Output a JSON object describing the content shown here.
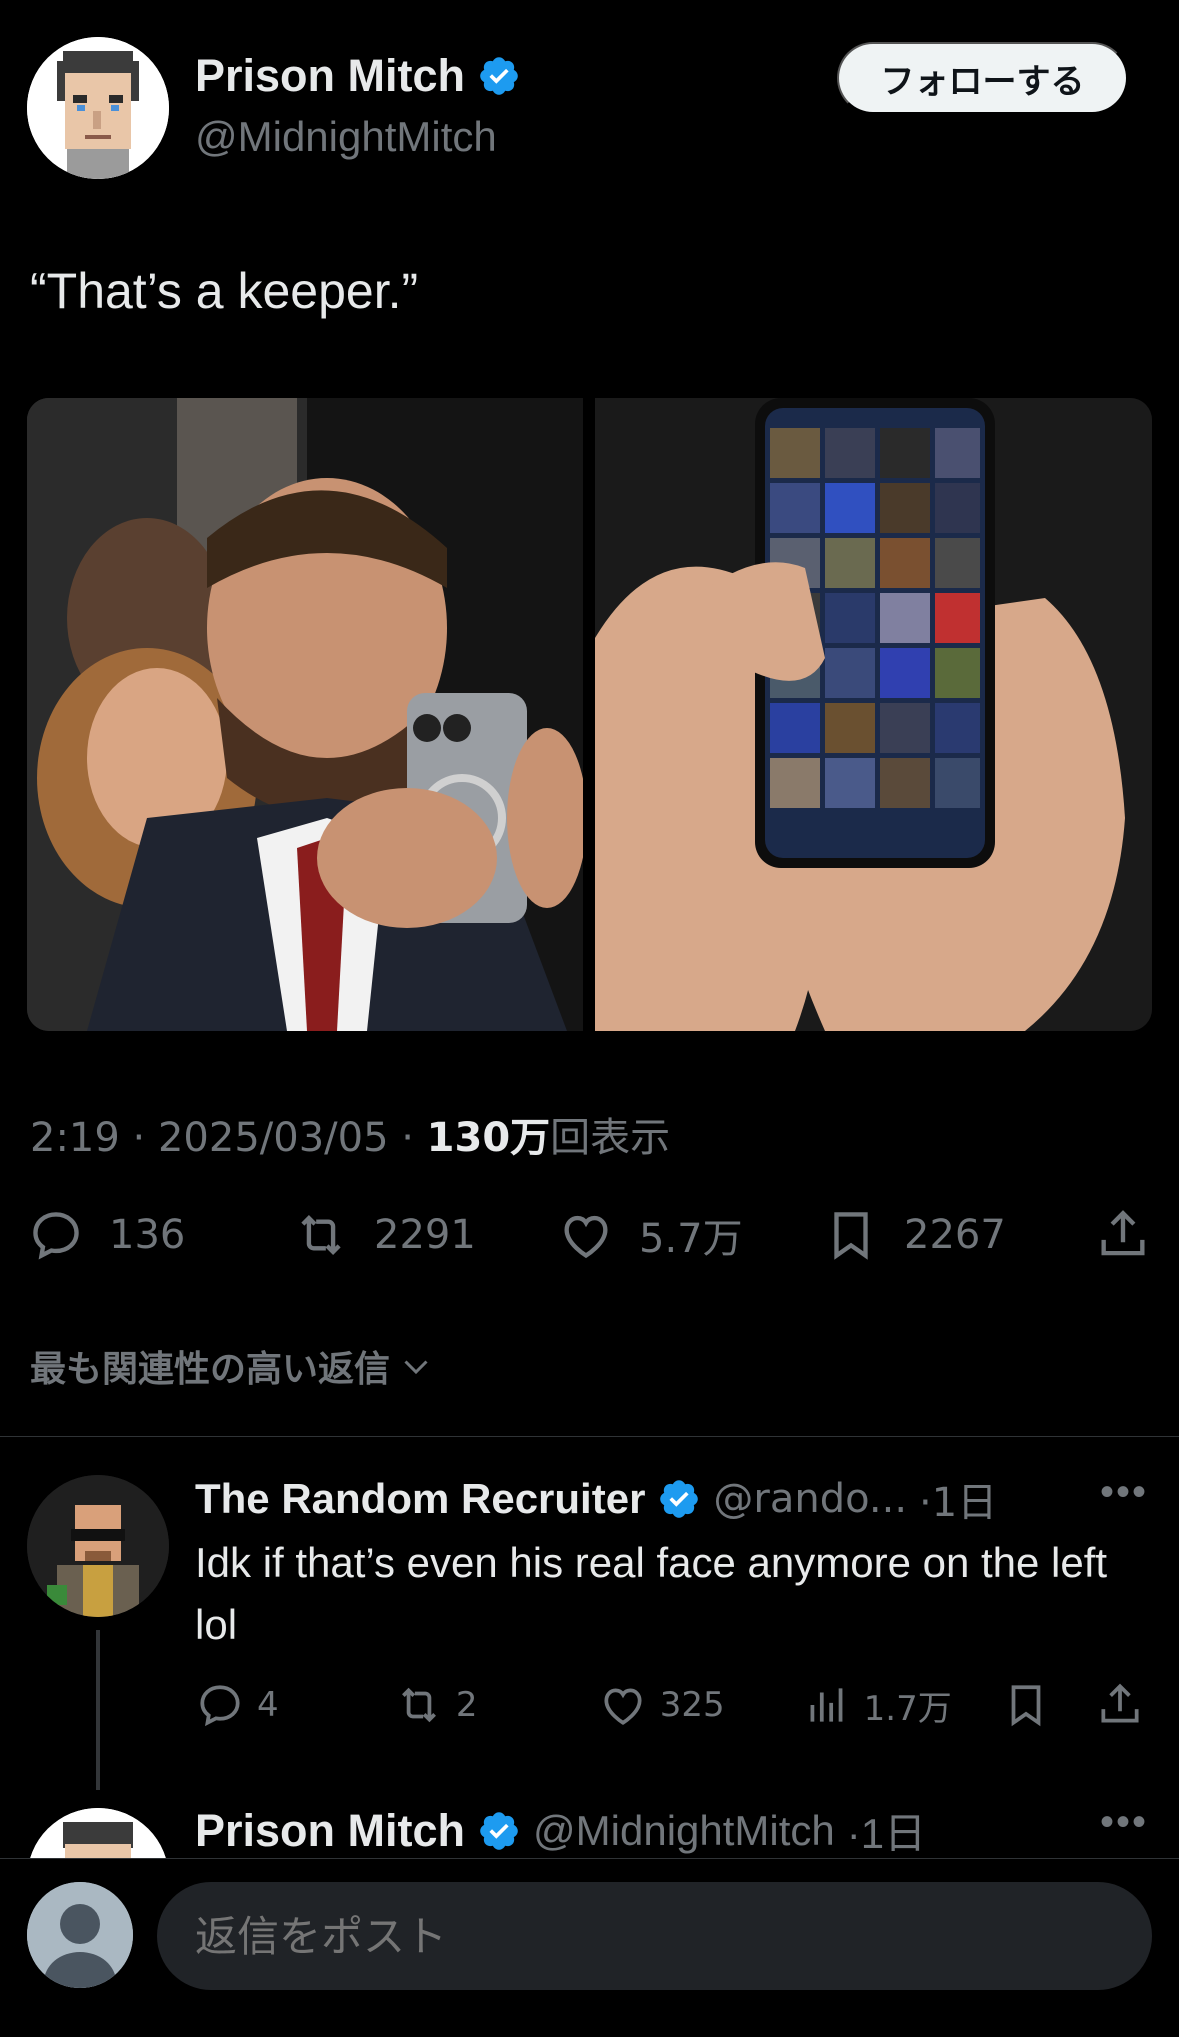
{
  "author": {
    "name": "Prison Mitch",
    "handle": "@MidnightMitch",
    "follow_label": "フォローする"
  },
  "tweet": {
    "text": "“That’s a keeper.”",
    "time": "2:19 · 2025/03/05 · ",
    "views_count": "130万",
    "views_label": "回表示"
  },
  "stats": {
    "replies": "136",
    "retweets": "2291",
    "likes": "5.7万",
    "bookmarks": "2267"
  },
  "sort_label": "最も関連性の高い返信",
  "reply": {
    "name": "The Random Recruiter",
    "handle": "@rando...",
    "time": "·1日",
    "text": "Idk if that’s even his real face anymore on the left lol",
    "replies": "4",
    "retweets": "2",
    "likes": "325",
    "views": "1.7万"
  },
  "reply2": {
    "name": "Prison Mitch",
    "handle": "@MidnightMitch",
    "time": "·1日"
  },
  "composer": {
    "placeholder": "返信をポスト"
  },
  "colors": {
    "verified": "#1d9bf0",
    "muted": "#71767b",
    "background": "#000000"
  }
}
